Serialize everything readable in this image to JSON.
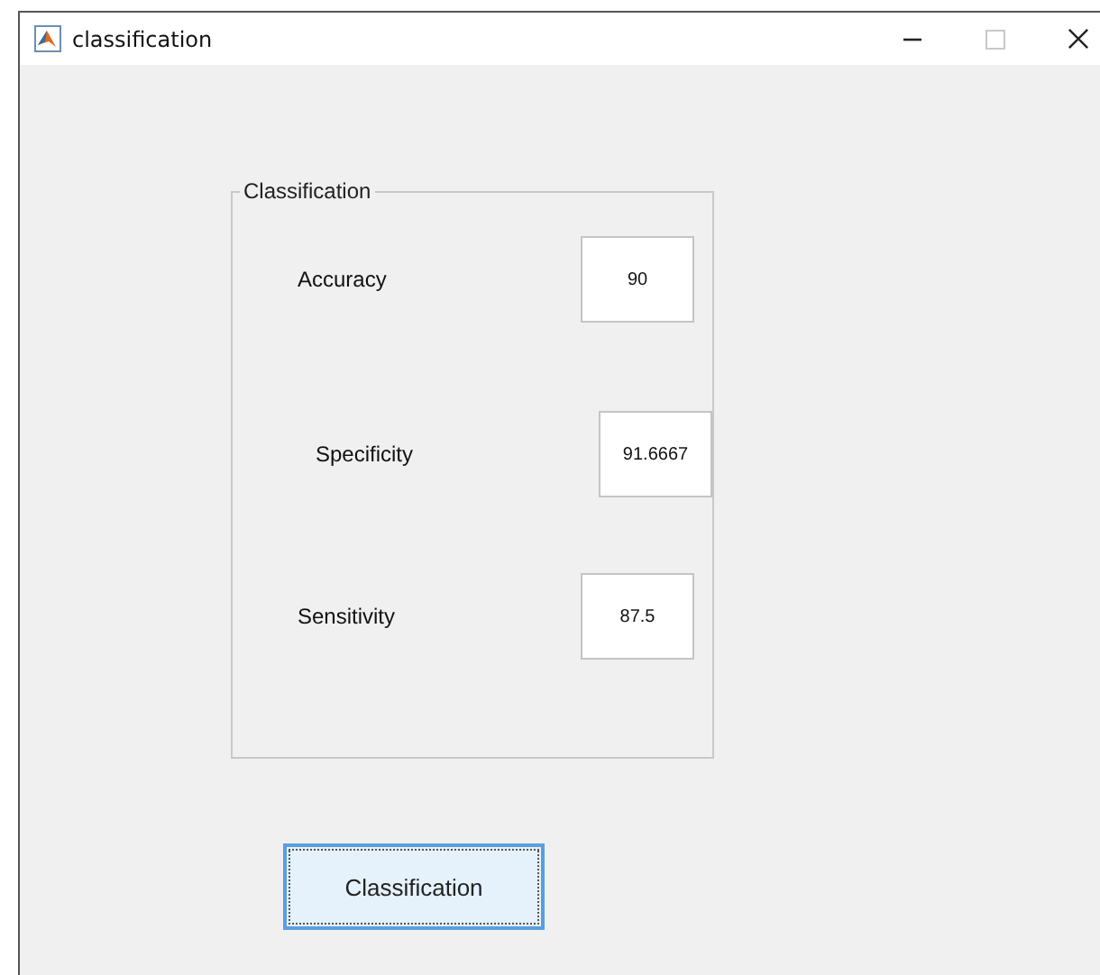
{
  "window": {
    "title": "classification",
    "controls": [
      {
        "kind": "minimize",
        "disabled": false
      },
      {
        "kind": "maximize",
        "disabled": true
      },
      {
        "kind": "close",
        "disabled": false
      }
    ]
  },
  "panel": {
    "title": "Classification",
    "fields": [
      {
        "label": "Accuracy",
        "value": "90"
      },
      {
        "label": "Specificity",
        "value": "91.6667"
      },
      {
        "label": "Sensitivity",
        "value": "87.5"
      }
    ]
  },
  "button": {
    "label": "Classification",
    "focused": true
  }
}
